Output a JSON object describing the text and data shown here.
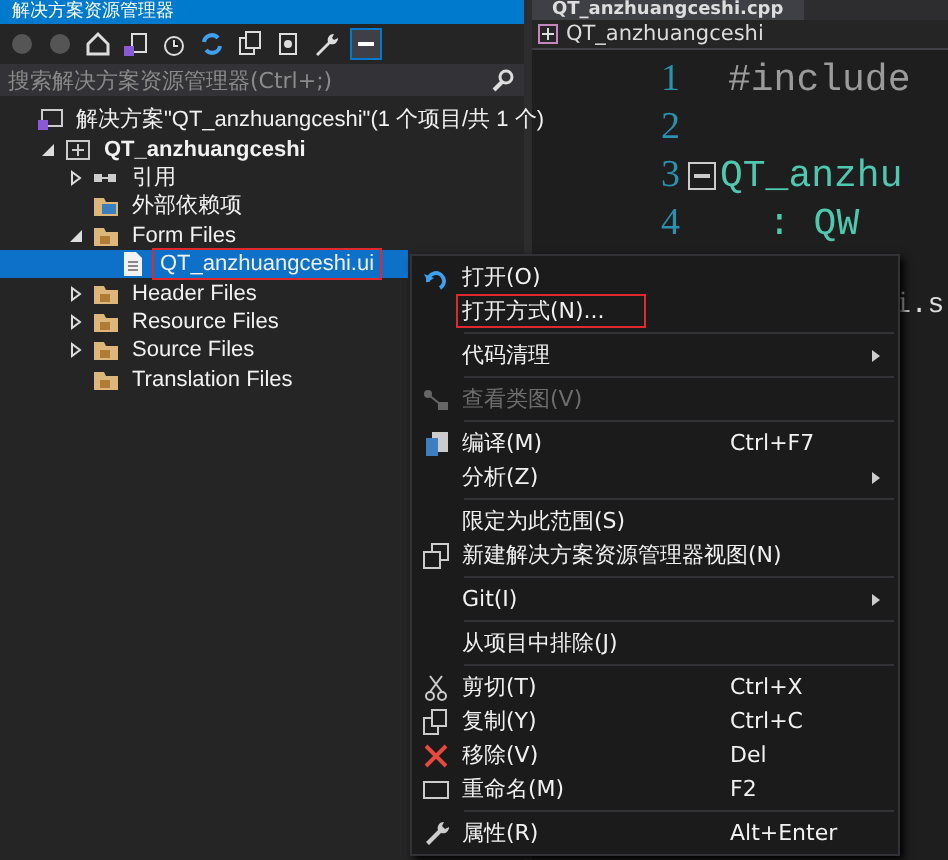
{
  "explorer": {
    "title": "解决方案资源管理器",
    "search": {
      "placeholder": "搜索解决方案资源管理器(Ctrl+;)"
    },
    "tree": [
      {
        "kind": "solution",
        "label": "解决方案\"QT_anzhuangceshi\"(1 个项目/共 1 个)",
        "selected": false,
        "annotated": false,
        "children": [
          {
            "kind": "project",
            "label": "QT_anzhuangceshi",
            "expanded": true,
            "selected": false,
            "annotated": false,
            "children": [
              {
                "kind": "reference",
                "label": "引用",
                "expanded": false,
                "selected": false,
                "annotated": false
              },
              {
                "kind": "external",
                "label": "外部依赖项",
                "selected": false,
                "annotated": false
              },
              {
                "kind": "folder",
                "label": "Form Files",
                "expanded": true,
                "selected": false,
                "annotated": false,
                "children": [
                  {
                    "kind": "file",
                    "label": "QT_anzhuangceshi.ui",
                    "selected": true,
                    "annotated": true
                  }
                ]
              },
              {
                "kind": "folder",
                "label": "Header Files",
                "expanded": false,
                "selected": false,
                "annotated": false
              },
              {
                "kind": "folder",
                "label": "Resource Files",
                "expanded": false,
                "selected": false,
                "annotated": false
              },
              {
                "kind": "folder",
                "label": "Source Files",
                "expanded": false,
                "selected": false,
                "annotated": false
              },
              {
                "kind": "folder",
                "label": "Translation Files",
                "selected": false,
                "annotated": false
              }
            ]
          }
        ]
      }
    ]
  },
  "editor": {
    "tab": "QT_anzhuangceshi.cpp",
    "breadcrumb": "QT_anzhuangceshi",
    "lines": [
      {
        "number": "1",
        "text": "#include",
        "kind": "plain"
      },
      {
        "number": "2",
        "kind": "plain"
      },
      {
        "number": "3",
        "text": "QT_anzhu",
        "kind": "type"
      },
      {
        "number": "4",
        "text": ": QW",
        "kind": "type"
      }
    ],
    "fragment": "i.s"
  },
  "context_menu": [
    {
      "kind": "item",
      "label": "打开(O)",
      "annotated": false,
      "disabled": false
    },
    {
      "kind": "item",
      "label": "打开方式(N)...",
      "annotated": true,
      "disabled": false
    },
    {
      "kind": "separator"
    },
    {
      "kind": "submenu",
      "label": "代码清理",
      "disabled": false
    },
    {
      "kind": "separator"
    },
    {
      "kind": "item",
      "label": "查看类图(V)",
      "annotated": false,
      "disabled": true
    },
    {
      "kind": "separator"
    },
    {
      "kind": "item",
      "label": "编译(M)",
      "shortcut": "Ctrl+F7",
      "annotated": false,
      "disabled": false
    },
    {
      "kind": "submenu",
      "label": "分析(Z)",
      "disabled": false
    },
    {
      "kind": "separator"
    },
    {
      "kind": "item",
      "label": "限定为此范围(S)",
      "annotated": false,
      "disabled": false
    },
    {
      "kind": "item",
      "label": "新建解决方案资源管理器视图(N)",
      "annotated": false,
      "disabled": false
    },
    {
      "kind": "separator"
    },
    {
      "kind": "submenu",
      "label": "Git(I)",
      "disabled": false
    },
    {
      "kind": "separator"
    },
    {
      "kind": "item",
      "label": "从项目中排除(J)",
      "annotated": false,
      "disabled": false
    },
    {
      "kind": "separator"
    },
    {
      "kind": "item",
      "label": "剪切(T)",
      "shortcut": "Ctrl+X",
      "annotated": false,
      "disabled": false
    },
    {
      "kind": "item",
      "label": "复制(Y)",
      "shortcut": "Ctrl+C",
      "annotated": false,
      "disabled": false
    },
    {
      "kind": "item",
      "label": "移除(V)",
      "shortcut": "Del",
      "annotated": false,
      "disabled": false
    },
    {
      "kind": "item",
      "label": "重命名(M)",
      "shortcut": "F2",
      "annotated": false,
      "disabled": false
    },
    {
      "kind": "separator"
    },
    {
      "kind": "item",
      "label": "属性(R)",
      "shortcut": "Alt+Enter",
      "annotated": false,
      "disabled": false
    }
  ]
}
